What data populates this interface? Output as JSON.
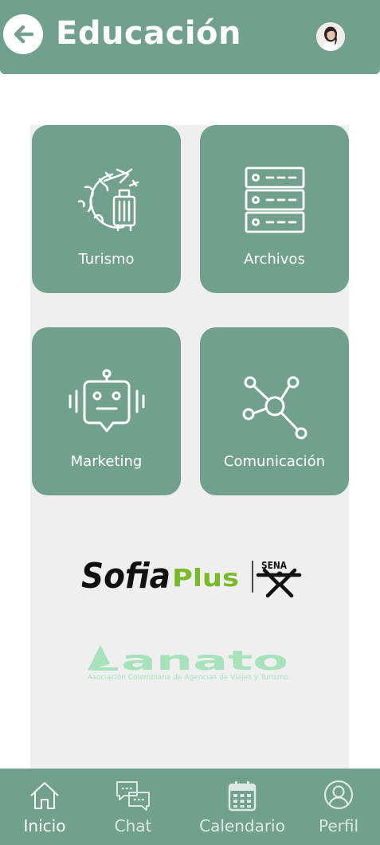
{
  "header": {
    "title": "Educación"
  },
  "cards": [
    {
      "label": "Turismo",
      "icon": "travel-globe-luggage-icon"
    },
    {
      "label": "Archivos",
      "icon": "server-rack-icon"
    },
    {
      "label": "Marketing",
      "icon": "robot-chat-icon"
    },
    {
      "label": "Comunicación",
      "icon": "network-nodes-icon"
    }
  ],
  "logos": {
    "sofia_part1": "Sofia",
    "sofia_part2": "Plus",
    "sena": "SENA",
    "anato": "anato",
    "anato_sub": "Asociación Colombiana de Agencias de Viajes y Turismo"
  },
  "nav": {
    "items": [
      {
        "label": "Inicio",
        "icon": "home-icon",
        "active": true
      },
      {
        "label": "Chat",
        "icon": "chat-bubbles-icon",
        "active": false
      },
      {
        "label": "Calendario",
        "icon": "calendar-icon",
        "active": false
      },
      {
        "label": "Perfil",
        "icon": "user-icon",
        "active": false
      }
    ]
  },
  "colors": {
    "primary": "#72a08e",
    "panel": "#efefef",
    "sofia_green": "#7ab929",
    "anato_green": "#a6e3bb",
    "text_light": "#ffffff"
  }
}
